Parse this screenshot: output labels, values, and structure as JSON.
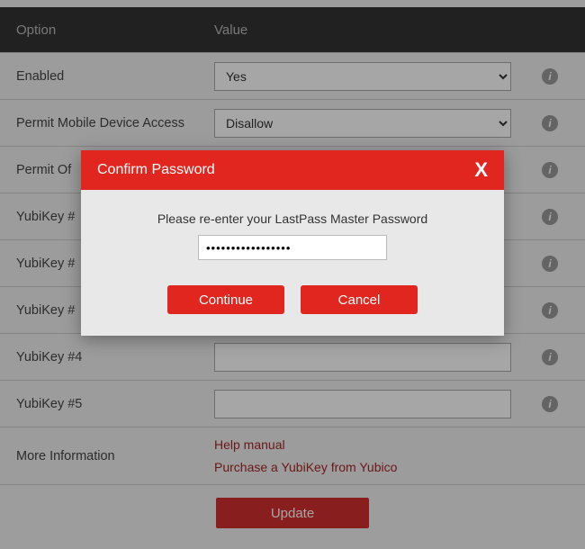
{
  "header": {
    "option": "Option",
    "value": "Value"
  },
  "rows": {
    "enabled": {
      "label": "Enabled",
      "value": "Yes"
    },
    "permit_mobile": {
      "label": "Permit Mobile Device Access",
      "value": "Disallow"
    },
    "permit_offline": {
      "label": "Permit Of"
    },
    "yk1": {
      "label": "YubiKey #",
      "value": ""
    },
    "yk2": {
      "label": "YubiKey #",
      "value": ""
    },
    "yk3": {
      "label": "YubiKey #",
      "value": ""
    },
    "yk4": {
      "label": "YubiKey #4",
      "value": ""
    },
    "yk5": {
      "label": "YubiKey #5",
      "value": ""
    },
    "more_info": {
      "label": "More Information",
      "link1": "Help manual",
      "link2": "Purchase a YubiKey from Yubico"
    }
  },
  "update_label": "Update",
  "modal": {
    "title": "Confirm Password",
    "close": "X",
    "prompt": "Please re-enter your LastPass Master Password",
    "password_value": "•••••••••••••••••",
    "continue": "Continue",
    "cancel": "Cancel"
  }
}
